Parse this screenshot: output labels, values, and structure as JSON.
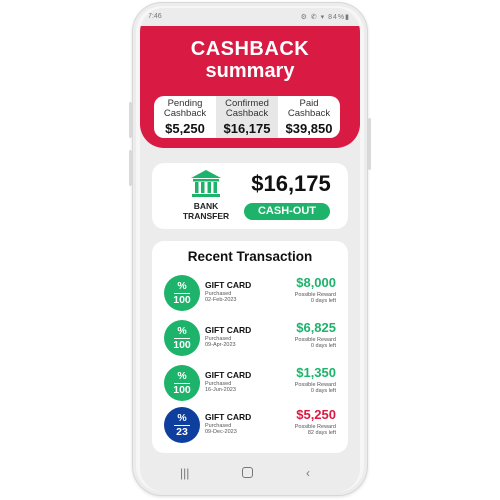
{
  "status_bar": {
    "time": "7:46",
    "notification_icon": "square-notification-icon",
    "icons_text": "⚙ ✆ ▾ 84%▮",
    "battery": "84%"
  },
  "header": {
    "title": "CASHBACK",
    "subtitle": "summary",
    "background_color": "#d91a43"
  },
  "summary": [
    {
      "label_line1": "Pending",
      "label_line2": "Cashback",
      "amount": "$5,250"
    },
    {
      "label_line1": "Confirmed",
      "label_line2": "Cashback",
      "amount": "$16,175"
    },
    {
      "label_line1": "Paid",
      "label_line2": "Cashback",
      "amount": "$39,850"
    }
  ],
  "bank": {
    "icon": "bank-icon",
    "label_line1": "BANK",
    "label_line2": "TRANSFER",
    "amount": "$16,175",
    "cashout_label": "CASH-OUT",
    "accent_color": "#1db36a"
  },
  "recent": {
    "title": "Recent  Transaction",
    "transactions": [
      {
        "percent": "%",
        "value": "100",
        "badge_color": "green",
        "name": "GIFT CARD",
        "purchased_label": "Purchased",
        "date": "02-Feb-2023",
        "amount": "$8,000",
        "amount_color": "green",
        "reward_label": "Possible Reward",
        "days_left": "0 days left"
      },
      {
        "percent": "%",
        "value": "100",
        "badge_color": "green",
        "name": "GIFT CARD",
        "purchased_label": "Purchased",
        "date": "09-Apr-2023",
        "amount": "$6,825",
        "amount_color": "green",
        "reward_label": "Possible Reward",
        "days_left": "0 days left"
      },
      {
        "percent": "%",
        "value": "100",
        "badge_color": "green",
        "name": "GIFT CARD",
        "purchased_label": "Purchased",
        "date": "16-Jun-2023",
        "amount": "$1,350",
        "amount_color": "green",
        "reward_label": "Possible Reward",
        "days_left": "0 days left"
      },
      {
        "percent": "%",
        "value": "23",
        "badge_color": "blue",
        "name": "GIFT CARD",
        "purchased_label": "Purchased",
        "date": "09-Dec-2023",
        "amount": "$5,250",
        "amount_color": "red",
        "reward_label": "Possible Reward",
        "days_left": "82 days left"
      }
    ]
  },
  "nav": {
    "recents": "|||",
    "back": "‹"
  }
}
